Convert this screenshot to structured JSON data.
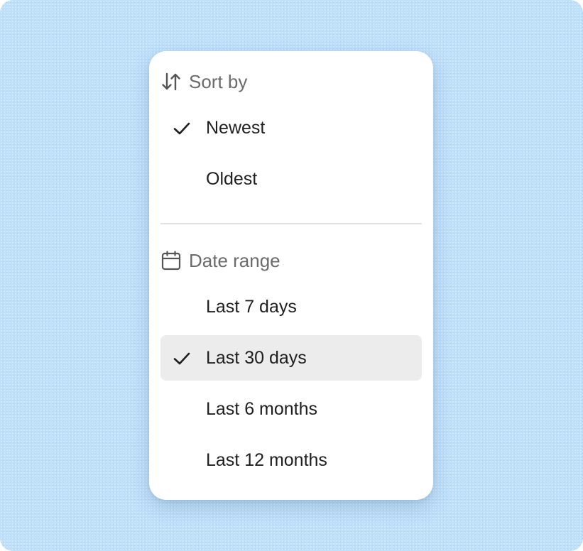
{
  "sort": {
    "title": "Sort by",
    "icon": "sort-arrows-icon",
    "options": [
      {
        "label": "Newest",
        "checked": true
      },
      {
        "label": "Oldest",
        "checked": false
      }
    ]
  },
  "date_range": {
    "title": "Date range",
    "icon": "calendar-icon",
    "options": [
      {
        "label": "Last 7 days",
        "checked": false
      },
      {
        "label": "Last 30 days",
        "checked": true,
        "highlighted": true
      },
      {
        "label": "Last 6 months",
        "checked": false
      },
      {
        "label": "Last 12 months",
        "checked": false
      }
    ]
  },
  "colors": {
    "background": "#bfe0fb",
    "menu": "#ffffff",
    "highlight": "#ececec",
    "header_text": "#6b6b6b",
    "item_text": "#1f1f1f"
  }
}
